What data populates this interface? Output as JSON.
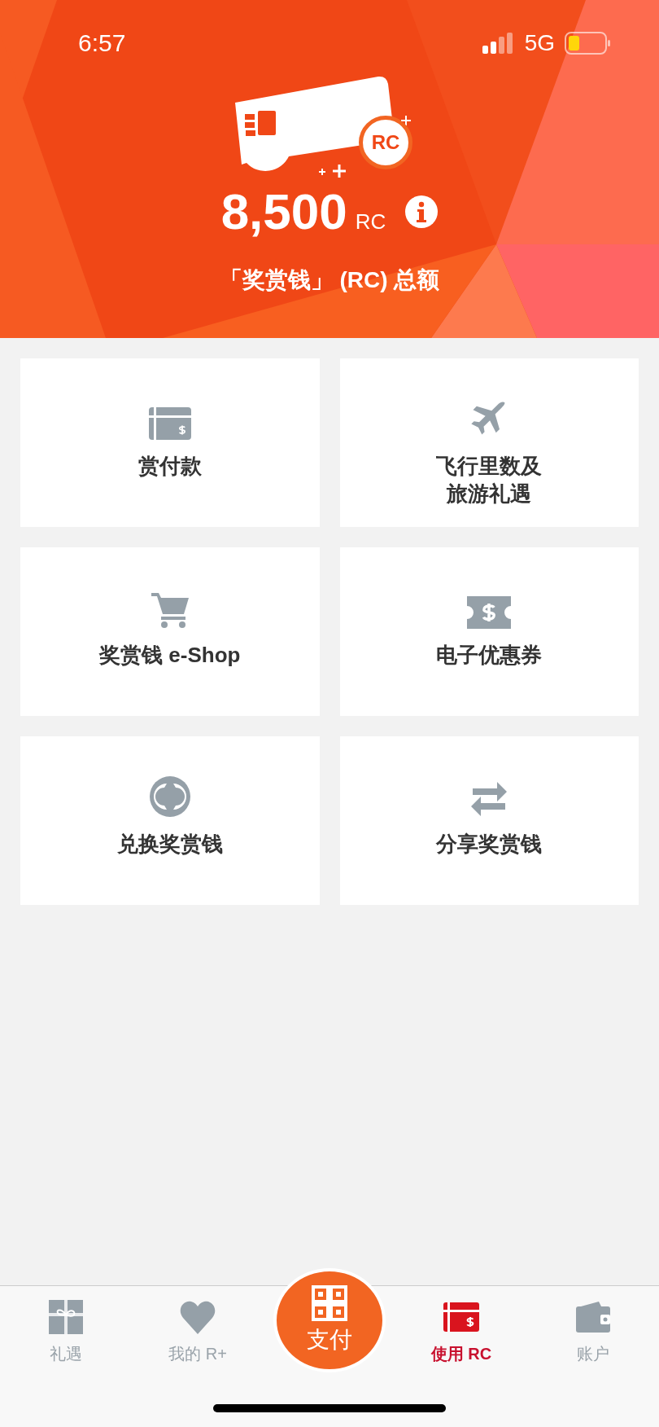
{
  "status_bar": {
    "time": "6:57",
    "network": "5G"
  },
  "header": {
    "badge": "RC",
    "amount": "8,500",
    "unit": "RC",
    "subtitle": "「奖赏钱」 (RC) 总额"
  },
  "tiles": [
    {
      "lines": [
        "赏付款"
      ]
    },
    {
      "lines": [
        "飞行里数及",
        "旅游礼遇"
      ]
    },
    {
      "lines": [
        "奖赏钱 e-Shop"
      ]
    },
    {
      "lines": [
        "电子优惠券"
      ]
    },
    {
      "lines": [
        "兑换奖赏钱"
      ]
    },
    {
      "lines": [
        "分享奖赏钱"
      ]
    }
  ],
  "tab_bar": [
    {
      "kind": "tab",
      "label": "礼遇",
      "selected": false
    },
    {
      "kind": "tab",
      "label": "我的 R+",
      "selected": false
    },
    {
      "kind": "pay",
      "label": "支付",
      "selected": false
    },
    {
      "kind": "tab",
      "label": "使用 RC",
      "selected": true
    },
    {
      "kind": "tab",
      "label": "账户",
      "selected": false
    }
  ]
}
